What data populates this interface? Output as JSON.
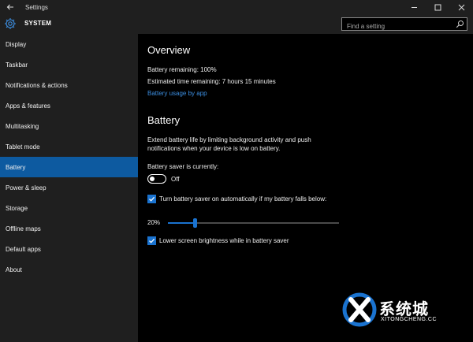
{
  "window": {
    "title": "Settings",
    "back_icon": "back-arrow-icon",
    "controls": [
      "minimize-icon",
      "maximize-icon",
      "close-icon"
    ]
  },
  "header": {
    "section_title": "SYSTEM",
    "icon": "gear-icon",
    "search_placeholder": "Find a setting"
  },
  "sidebar": {
    "items": [
      {
        "label": "Display"
      },
      {
        "label": "Taskbar"
      },
      {
        "label": "Notifications & actions"
      },
      {
        "label": "Apps & features"
      },
      {
        "label": "Multitasking"
      },
      {
        "label": "Tablet mode"
      },
      {
        "label": "Battery",
        "active": true
      },
      {
        "label": "Power & sleep"
      },
      {
        "label": "Storage"
      },
      {
        "label": "Offline maps"
      },
      {
        "label": "Default apps"
      },
      {
        "label": "About"
      }
    ]
  },
  "overview": {
    "heading": "Overview",
    "remaining": "Battery remaining: 100%",
    "time": "Estimated time remaining: 7 hours 15 minutes",
    "link": "Battery usage by app"
  },
  "battery": {
    "heading": "Battery",
    "description_line1": "Extend battery life by limiting background activity and push",
    "description_line2": "notifications when your device is low on battery.",
    "saver_label": "Battery saver is currently:",
    "saver_state": "Off",
    "auto_saver_label": "Turn battery saver on automatically if my battery falls below:",
    "threshold_label": "20%",
    "threshold_value": 20,
    "brightness_label": "Lower screen brightness while in battery saver"
  },
  "watermark": {
    "icon": "x-logo-icon",
    "text_cn": "系统城",
    "text_en": "XITONGCHENG.CC"
  },
  "colors": {
    "accent": "#0d5aa0",
    "checkbox": "#1a73d0",
    "link": "#3c8ee0",
    "sidebar_bg": "#1f1f1f",
    "content_bg": "#000000"
  }
}
